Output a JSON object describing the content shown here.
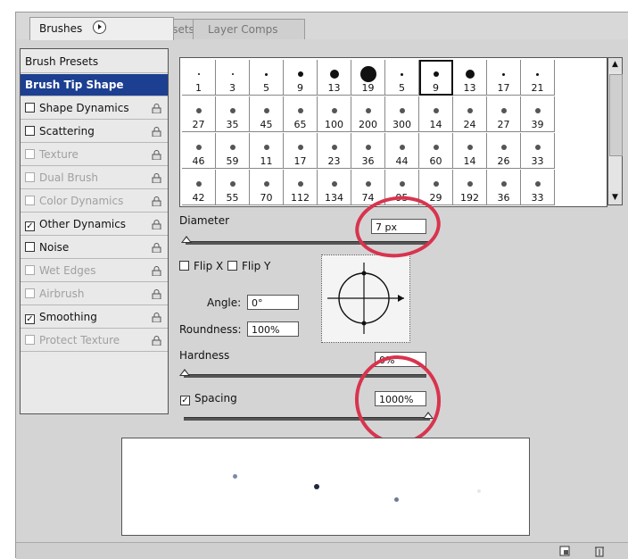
{
  "tabs": [
    {
      "label": "Brushes",
      "active": true
    },
    {
      "label": "Tool Presets",
      "active": false
    },
    {
      "label": "Layer Comps",
      "active": false
    }
  ],
  "left_list": [
    {
      "label": "Brush Presets",
      "type": "header",
      "checked": null,
      "enabled": true,
      "lock": false
    },
    {
      "label": "Brush Tip Shape",
      "type": "selected",
      "checked": null,
      "enabled": true,
      "lock": false
    },
    {
      "label": "Shape Dynamics",
      "checked": false,
      "enabled": true,
      "lock": true
    },
    {
      "label": "Scattering",
      "checked": false,
      "enabled": true,
      "lock": true
    },
    {
      "label": "Texture",
      "checked": false,
      "enabled": false,
      "lock": true
    },
    {
      "label": "Dual Brush",
      "checked": false,
      "enabled": false,
      "lock": true
    },
    {
      "label": "Color Dynamics",
      "checked": false,
      "enabled": false,
      "lock": true
    },
    {
      "label": "Other Dynamics",
      "checked": true,
      "enabled": true,
      "lock": true
    },
    {
      "label": "Noise",
      "checked": false,
      "enabled": true,
      "lock": true
    },
    {
      "label": "Wet Edges",
      "checked": false,
      "enabled": false,
      "lock": true
    },
    {
      "label": "Airbrush",
      "checked": false,
      "enabled": false,
      "lock": true
    },
    {
      "label": "Smoothing",
      "checked": true,
      "enabled": true,
      "lock": true
    },
    {
      "label": "Protect Texture",
      "checked": false,
      "enabled": false,
      "lock": true
    }
  ],
  "brush_grid": [
    [
      "1",
      "3",
      "5",
      "9",
      "13",
      "19",
      "5",
      "9",
      "13",
      "17",
      "21"
    ],
    [
      "27",
      "35",
      "45",
      "65",
      "100",
      "200",
      "300",
      "14",
      "24",
      "27",
      "39"
    ],
    [
      "46",
      "59",
      "11",
      "17",
      "23",
      "36",
      "44",
      "60",
      "14",
      "26",
      "33"
    ],
    [
      "42",
      "55",
      "70",
      "112",
      "134",
      "74",
      "95",
      "29",
      "192",
      "36",
      "33"
    ]
  ],
  "controls": {
    "diameter_label": "Diameter",
    "diameter_value": "7 px",
    "flip_x_label": "Flip X",
    "flip_y_label": "Flip Y",
    "angle_label": "Angle:",
    "angle_value": "0°",
    "roundness_label": "Roundness:",
    "roundness_value": "100%",
    "hardness_label": "Hardness",
    "hardness_value": "0%",
    "spacing_label": "Spacing",
    "spacing_value": "1000%",
    "spacing_checked": true
  },
  "colors": {
    "selection": "#1d3f91",
    "annotation": "#d8344e"
  }
}
